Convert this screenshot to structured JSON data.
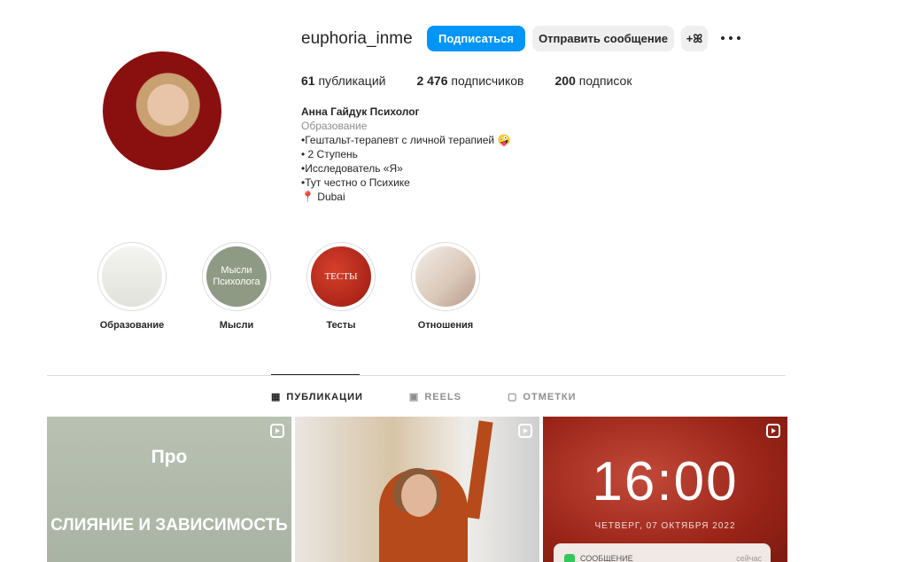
{
  "profile": {
    "username": "euphoria_inme",
    "follow_label": "Подписаться",
    "message_label": "Отправить сообщение",
    "add_user_icon": "+ꕤ"
  },
  "stats": {
    "posts_count": "61",
    "posts_label": "публикаций",
    "followers_count": "2 476",
    "followers_label": "подписчиков",
    "following_count": "200",
    "following_label": "подписок"
  },
  "bio": {
    "name": "Анна Гайдук Психолог",
    "category": "Образование",
    "lines": [
      "•Гештальт-терапевт с личной терапией 🤪",
      "• 2 Ступень",
      "•Исследователь «Я»",
      "•Тут честно о Психике",
      "📍 Dubai"
    ]
  },
  "highlights": [
    {
      "label": "Образование",
      "inner_text": ""
    },
    {
      "label": "Мысли",
      "inner_text": "Мысли Психолога"
    },
    {
      "label": "Тесты",
      "inner_text": "ТЕСТЫ"
    },
    {
      "label": "Отношения",
      "inner_text": ""
    }
  ],
  "tabs": [
    {
      "label": "ПУБЛИКАЦИИ",
      "icon": "grid-icon"
    },
    {
      "label": "REELS",
      "icon": "reels-icon"
    },
    {
      "label": "ОТМЕТКИ",
      "icon": "tagged-icon"
    }
  ],
  "posts": [
    {
      "title": "Про",
      "subtitle": "СЛИЯНИЕ И ЗАВИСИМОСТЬ"
    },
    {},
    {
      "time": "16:00",
      "date": "ЧЕТВЕРГ, 07 ОКТЯБРЯ 2022",
      "note": "СООБЩЕНИЕ",
      "note_time": "сейчас"
    }
  ],
  "colors": {
    "accent": "#0095f6",
    "button_gray": "#efefef"
  }
}
